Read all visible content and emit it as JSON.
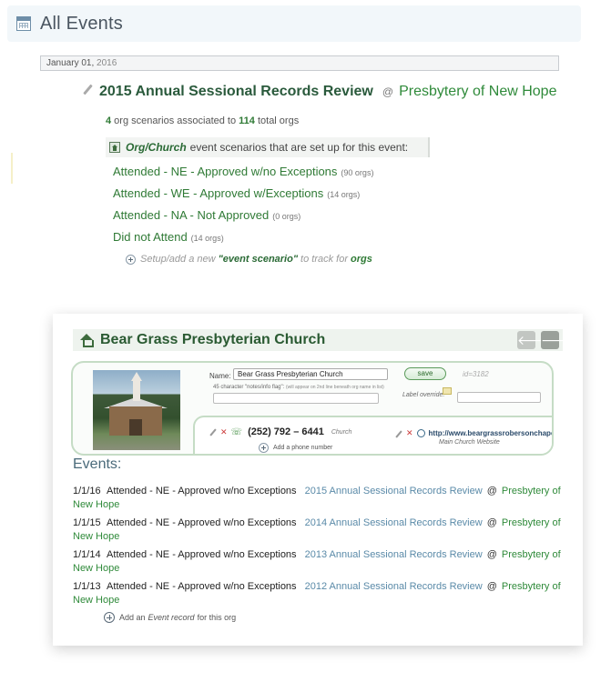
{
  "header": {
    "title": "All Events"
  },
  "date_bar": {
    "date_prefix": "January 01",
    "date_sep": ",",
    "date_year": " 2016"
  },
  "event": {
    "title": "2015 Annual Sessional Records Review",
    "at": "@",
    "presbytery": "Presbytery of New Hope",
    "summary": {
      "scenario_count": "4",
      "text_mid": " org scenarios associated to ",
      "org_count": "114",
      "text_end": " total orgs"
    },
    "scenario_header": {
      "org_church": "Org/Church",
      "text": " event scenarios that are set up for this event:"
    },
    "scenarios": [
      {
        "label": "Attended - NE - Approved w/no Exceptions",
        "count": "(90 orgs)"
      },
      {
        "label": "Attended - WE - Approved w/Exceptions",
        "count": "(14 orgs)"
      },
      {
        "label": "Attended - NA - Not Approved",
        "count": "(0 orgs)"
      },
      {
        "label": "Did not Attend",
        "count": "(14 orgs)"
      }
    ],
    "add_scenario": {
      "prefix": "Setup/add a new",
      "link": "\"event scenario\"",
      "mid": "to track for",
      "orgs": "orgs"
    }
  },
  "org": {
    "name": "Bear Grass Presbyterian Church",
    "nav_prev": "🡐",
    "nav_next": "🡒",
    "form": {
      "name_label": "Name:",
      "name_value": "Bear Grass Presbyterian Church",
      "save_label": "save",
      "id_text": "id=3182",
      "notes_label": "45 character \"notes/info flag\":",
      "notes_hint": "(will appear on 2nd line beneath org name in list)",
      "override_label": "Label override:"
    },
    "contact": {
      "x": "✕",
      "phone_icon": "☏",
      "phone": "(252) 792 – 6441",
      "phone_label": "Church",
      "add_phone": "Add a phone number",
      "url": "http://www.beargrassrobersonchapelpc...",
      "web_label": "Main Church Website"
    },
    "events_heading": "Events:",
    "events": [
      {
        "date": "1/1/16",
        "scenario": "Attended - NE - Approved w/no Exceptions",
        "event": "2015 Annual Sessional Records Review",
        "at": "@",
        "presbytery": "Presbytery of New Hope"
      },
      {
        "date": "1/1/15",
        "scenario": "Attended - NE - Approved w/no Exceptions",
        "event": "2014 Annual Sessional Records Review",
        "at": "@",
        "presbytery": "Presbytery of New Hope"
      },
      {
        "date": "1/1/14",
        "scenario": "Attended - NE - Approved w/no Exceptions",
        "event": "2013 Annual Sessional Records Review",
        "at": "@",
        "presbytery": "Presbytery of New Hope"
      },
      {
        "date": "1/1/13",
        "scenario": "Attended - NE - Approved w/no Exceptions",
        "event": "2012 Annual Sessional Records Review",
        "at": "@",
        "presbytery": "Presbytery of New Hope"
      }
    ],
    "add_event": {
      "prefix": "Add an",
      "em": "Event record",
      "suffix": "for this org"
    }
  },
  "colors": {
    "accent_green": "#2f8a3a",
    "link_blue": "#5a8aa8",
    "header_bg": "#f2f7fa"
  }
}
